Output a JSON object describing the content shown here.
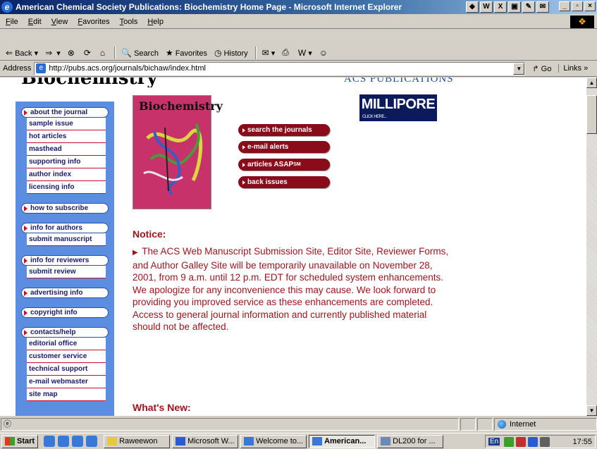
{
  "window": {
    "title": "American Chemical Society Publications: Biochemistry Home Page - Microsoft Internet Explorer"
  },
  "menu": [
    "File",
    "Edit",
    "View",
    "Favorites",
    "Tools",
    "Help"
  ],
  "toolbar": {
    "back": "Back",
    "search": "Search",
    "favorites": "Favorites",
    "history": "History"
  },
  "address": {
    "label": "Address",
    "url": "http://pubs.acs.org/journals/bichaw/index.html",
    "go": "Go",
    "links": "Links"
  },
  "page": {
    "header_logo": "Biochemistry",
    "acs_logo": "ACS PUBLICATIONS",
    "cover_title": "Biochemistry",
    "millipore": "MILLIPORE",
    "millipore_click": "CLICK HERE...",
    "sidebar": [
      {
        "label": "about the journal",
        "subs": [
          "sample issue",
          "hot articles",
          "masthead",
          "supporting info",
          "author index",
          "licensing info"
        ]
      },
      {
        "label": "how to subscribe",
        "subs": []
      },
      {
        "label": "info for authors",
        "subs": [
          "submit manuscript"
        ]
      },
      {
        "label": "info for reviewers",
        "subs": [
          "submit review"
        ]
      },
      {
        "label": "advertising info",
        "subs": []
      },
      {
        "label": "copyright info",
        "subs": []
      },
      {
        "label": "contacts/help",
        "subs": [
          "editorial office",
          "customer service",
          "technical support",
          "e-mail webmaster",
          "site map"
        ]
      }
    ],
    "actions": [
      "search the journals",
      "e-mail alerts",
      "articles ASAP",
      "back issues"
    ],
    "actions_sup": "SM",
    "notice_heading": "Notice:",
    "notice_text": "The ACS Web Manuscript Submission Site, Editor Site, Reviewer Forms, and Author Galley Site will be temporarily unavailable on November 28, 2001, from 9 a.m. until 12 p.m. EDT for scheduled system enhancements. We apologize for any inconvenience this may cause. We look forward to providing you improved service as these enhancements are completed. Access to general journal information and currently published material should not be affected.",
    "whats_new": "What's New:"
  },
  "status": {
    "zone": "Internet"
  },
  "taskbar": {
    "start": "Start",
    "tasks": [
      "Raweewon",
      "Microsoft W...",
      "Welcome to...",
      "American...",
      "DL200 for ..."
    ],
    "lang": "En",
    "clock": "17:55"
  }
}
